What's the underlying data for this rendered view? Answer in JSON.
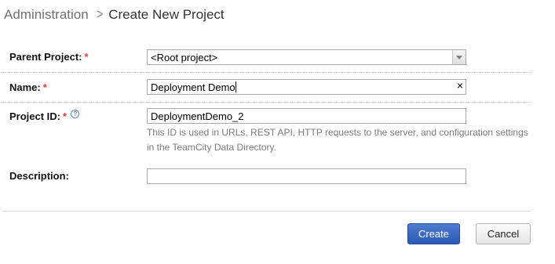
{
  "breadcrumb": {
    "parent": "Administration",
    "separator": ">",
    "current": "Create New Project"
  },
  "form": {
    "parent_project": {
      "label": "Parent Project:",
      "required_mark": "*",
      "value": "<Root project>"
    },
    "name": {
      "label": "Name:",
      "required_mark": "*",
      "value": "Deployment Demo",
      "clear_icon": "×"
    },
    "project_id": {
      "label": "Project ID:",
      "required_mark": "*",
      "help_icon": "?",
      "value": "DeploymentDemo_2",
      "hint_line1": "This ID is used in URLs, REST API, HTTP requests to the server, and configuration settings",
      "hint_line2": "in the TeamCity Data Directory."
    },
    "description": {
      "label": "Description:",
      "value": ""
    }
  },
  "actions": {
    "create_label": "Create",
    "cancel_label": "Cancel"
  },
  "colors": {
    "required": "#e23a3a",
    "primary_button": "#2c5ab4",
    "hint_text": "#7a7a7a"
  }
}
